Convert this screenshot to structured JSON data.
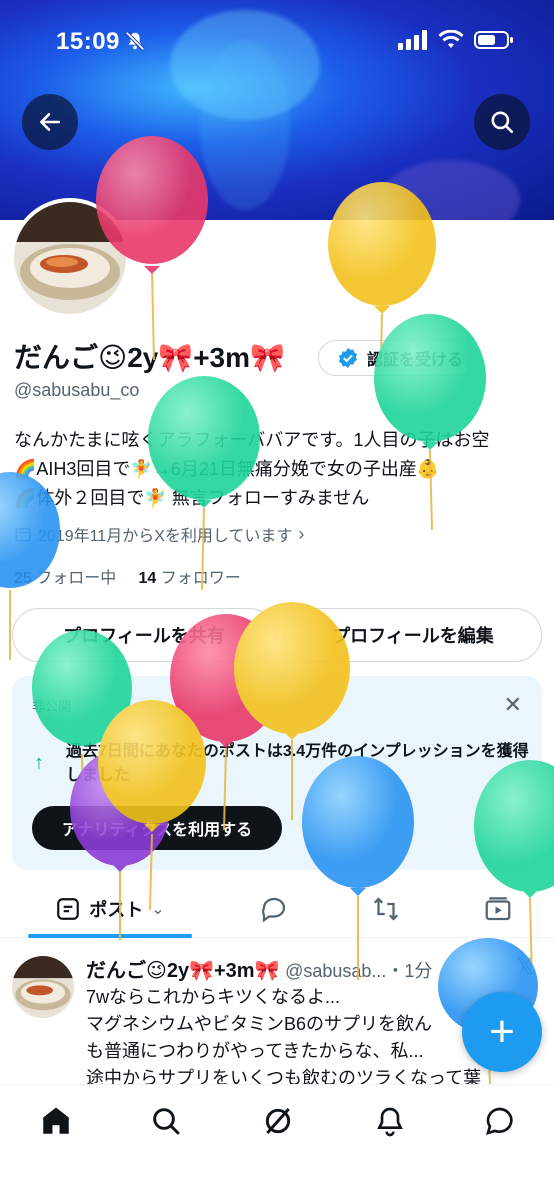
{
  "status": {
    "time": "15:09"
  },
  "profile": {
    "name": "だんご😉2y🎀+3m🎀",
    "handle": "@sabusabu_co",
    "verify_label": "認証を受ける",
    "bio_lines": [
      "なんかたまに呟くアラフォーババアです。1人目の子はお空",
      "🌈AIH3回目で🧚→6月21日無痛分娩で女の子出産👶",
      "🌈体外２回目で🧚 無言フォローすみません"
    ],
    "joined": "2019年11月からXを利用しています",
    "following_count": "25",
    "following_label": "フォロー中",
    "followers_count": "14",
    "followers_label": "フォロワー"
  },
  "buttons": {
    "share": "プロフィールを共有",
    "edit": "プロフィールを編集"
  },
  "analytics": {
    "private_label": "非公開",
    "message": "過去7日間にあなたのポストは3.4万件のインプレッションを獲得しました",
    "cta": "アナリティクスを利用する"
  },
  "tabs": [
    {
      "label": "ポスト"
    }
  ],
  "tweet": {
    "name": "だんご😉2y🎀+3m🎀",
    "handle": "@sabusab...",
    "time": "・1分",
    "lines": [
      "7wならこれからキツくなるよ...",
      "マグネシウムやビタミンB6のサプリを飲ん",
      "も普通につわりがやってきたからな、私...",
      "途中からサプリをいくつも飲むのツラくなって葉"
    ]
  },
  "colors": {
    "accent": "#1d9bf0",
    "text": "#0f1419",
    "muted": "#536471",
    "analytics_bg": "#eaf5fc"
  }
}
